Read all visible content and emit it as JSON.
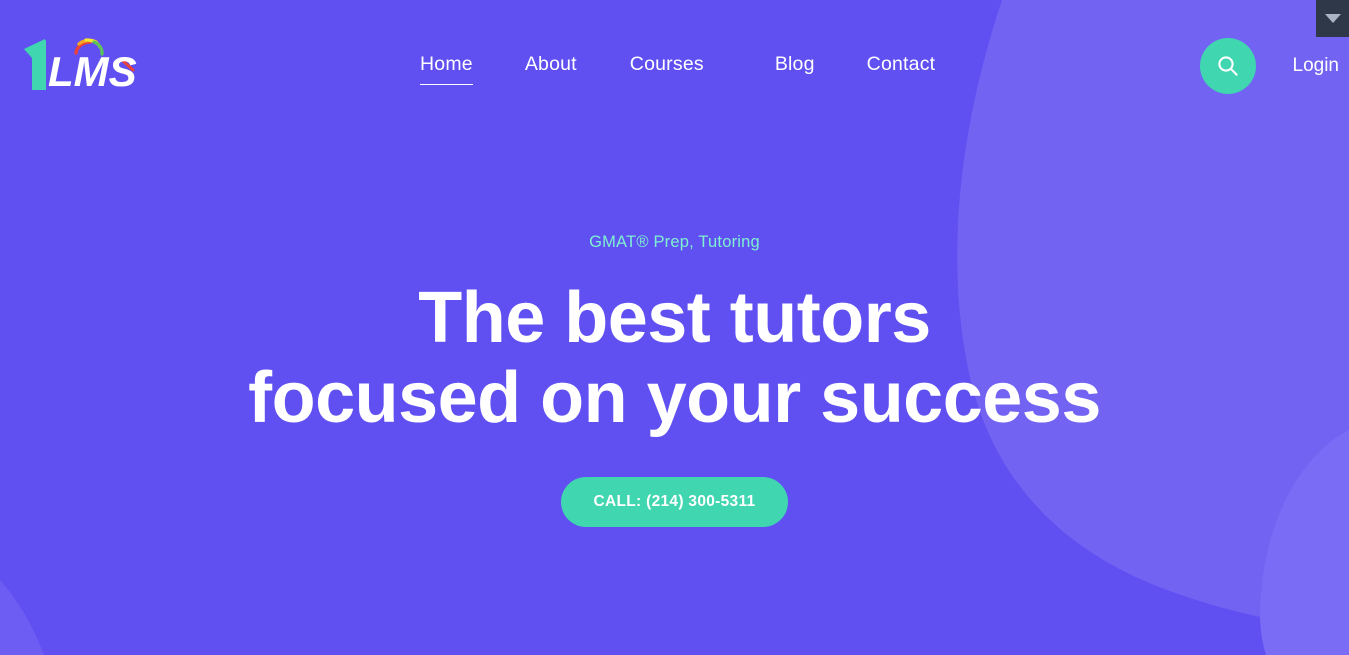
{
  "brand": {
    "name": "1LMS",
    "numeral": "1",
    "word": "LMS",
    "numeral_color": "#3fd6b0",
    "word_color": "#ffffff",
    "arc_colors": [
      "#e8413c",
      "#f5a623",
      "#f7e733",
      "#5ec45a",
      "#3fa9f5"
    ]
  },
  "nav": {
    "items": [
      {
        "label": "Home",
        "active": true
      },
      {
        "label": "About",
        "active": false
      },
      {
        "label": "Courses",
        "active": false
      },
      {
        "label": "Blog",
        "active": false
      },
      {
        "label": "Contact",
        "active": false
      }
    ],
    "search_icon": "search-icon",
    "login_label": "Login"
  },
  "hero": {
    "eyebrow": "GMAT® Prep, Tutoring",
    "title_line_1": "The best tutors",
    "title_line_2": "focused on your success",
    "cta_label": "CALL: (214) 300-5311"
  },
  "browser_chip": {
    "icon": "chevron-down-icon"
  },
  "theme": {
    "background": "#6050f2",
    "blob": "#7263f3",
    "accent_teal": "#3fd6b0",
    "eyebrow_text": "#7ff0d0",
    "text_white": "#ffffff",
    "chip_dark": "#2e3848",
    "chip_icon": "#aab4c4"
  }
}
